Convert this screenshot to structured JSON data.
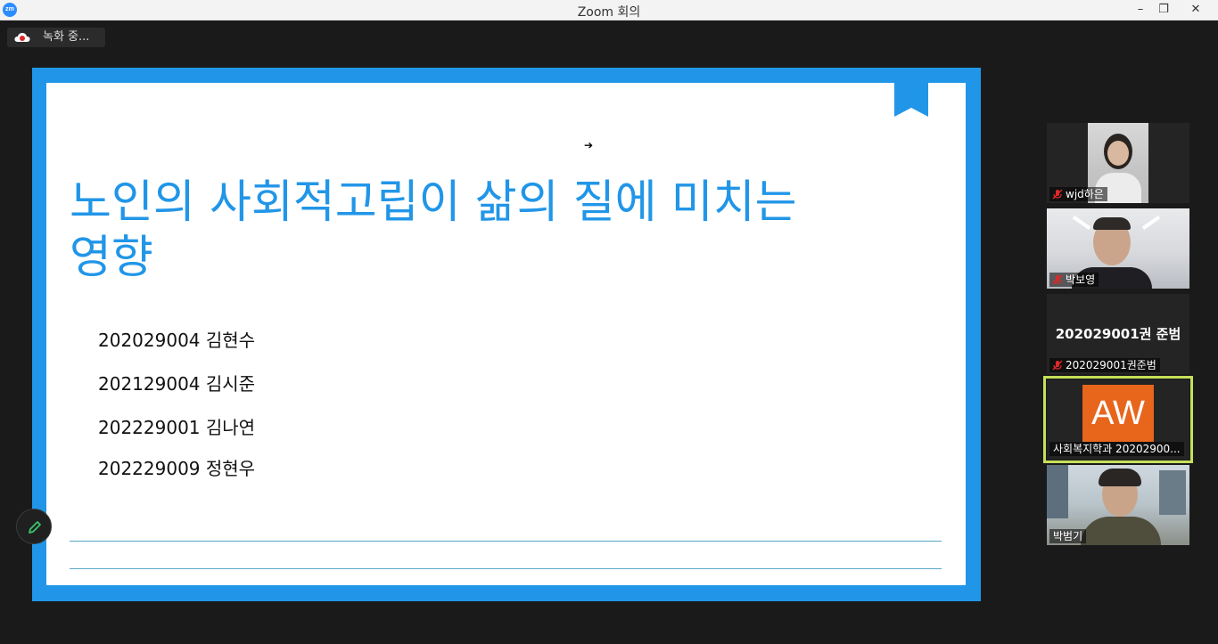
{
  "window": {
    "title": "Zoom 회의",
    "app_icon_label": "zm",
    "minimize": "–",
    "restore": "❐",
    "close": "✕"
  },
  "recording": {
    "label": "녹화 중..."
  },
  "slide": {
    "title_line1": "노인의 사회적고립이 삶의 질에 미치는",
    "title_line2": "영향",
    "cursor": "➔",
    "members": [
      "202029004 김현수",
      "202129004 김시준",
      "202229001 김나연",
      "202229009 정현우"
    ],
    "accent_color": "#2196e8"
  },
  "participants": [
    {
      "name": "wjd하은",
      "muted": true,
      "video": true
    },
    {
      "name": "박보영",
      "muted": true,
      "video": true
    },
    {
      "name": "202029001권준범",
      "display_name": "202029001권 준범",
      "muted": true,
      "video": false
    },
    {
      "name": "사회복지학과 20202900...",
      "avatar_text": "AW",
      "muted": false,
      "video": false,
      "active_speaker": true
    },
    {
      "name": "박범기",
      "muted": false,
      "video": true
    }
  ],
  "tools": {
    "annotate_icon": "pencil-icon"
  }
}
